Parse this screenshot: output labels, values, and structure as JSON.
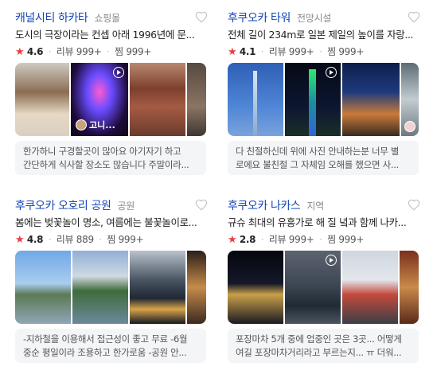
{
  "cards": [
    {
      "title": "캐널시티 하카타",
      "category": "쇼핑몰",
      "description": "도시의 극장이라는 컨셉 아래 1996년에 문...",
      "rating": "4.6",
      "reviews": "리뷰 999+",
      "saves": "찜 999+",
      "photo_overlay": "고니...",
      "review_lines": [
        "한가하니 구경할곳이 많아요 아기자기 하고",
        "간단하게 식사할 장소도 많습니다 주말이라..."
      ]
    },
    {
      "title": "후쿠오카 타워",
      "category": "전망시설",
      "description": "전체 길이 234m로 일본 제일의 높이를 자랑...",
      "rating": "4.1",
      "reviews": "리뷰 999+",
      "saves": "찜 999+",
      "review_lines": [
        "다 친절하신데 위에 사진 안내하는분 너무 별",
        "로에요 불친절 그 자체임 오해를 했으면 사..."
      ]
    },
    {
      "title": "후쿠오카 오호리 공원",
      "category": "공원",
      "description": "봄에는 벚꽃놀이 명소, 여름에는 불꽃놀이로...",
      "rating": "4.8",
      "reviews": "리뷰 889",
      "saves": "찜 999+",
      "review_lines": [
        "-지하철을 이용해서 접근성이 좋고 무료 -6월",
        "중순 평일이라 조용하고 한가로움 -공원 안..."
      ]
    },
    {
      "title": "후쿠오카 나카스",
      "category": "지역",
      "description": "규슈 최대의 유흥가로 해 질 녘과 함께 나카...",
      "rating": "2.8",
      "reviews": "리뷰 999+",
      "saves": "찜 999+",
      "review_lines": [
        "포장마차 5개 중에 업중인 곳은 3곳... 어떻게",
        "여길 포장마차거리라고 부르는지... ㅠ 더워..."
      ]
    }
  ],
  "icons": {
    "heart": "heart-outline-icon",
    "star": "star-icon",
    "play": "video-play-icon"
  },
  "colors": {
    "title": "#1446b8",
    "star": "#ea3d3d",
    "review_bg": "#f4f5f7"
  }
}
